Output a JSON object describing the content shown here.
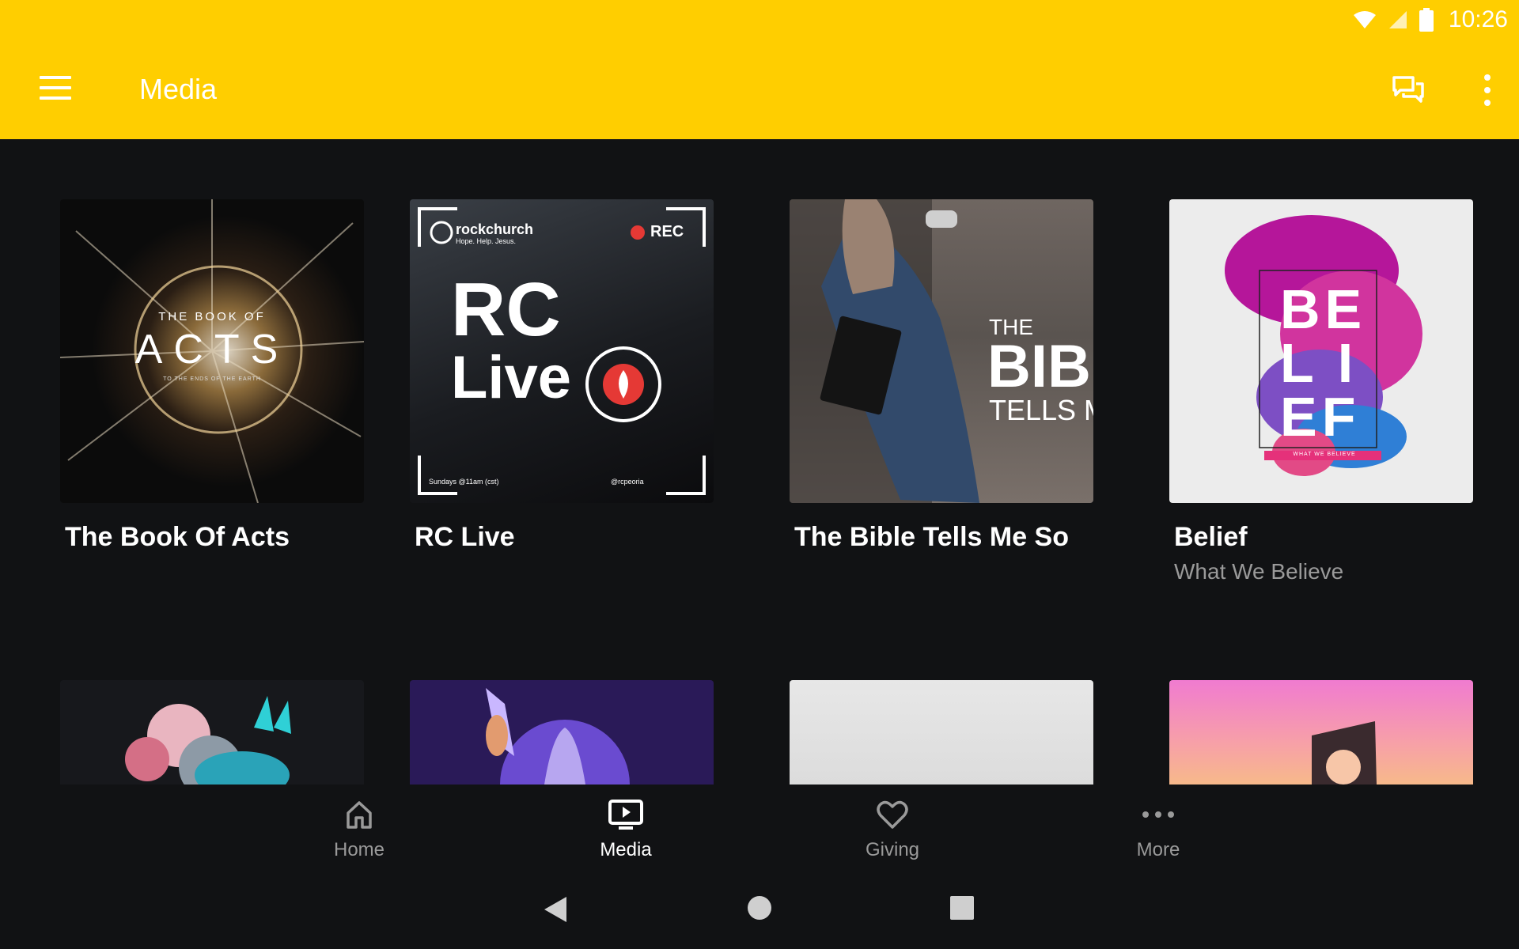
{
  "status_bar": {
    "time": "10:26"
  },
  "app_bar": {
    "title": "Media"
  },
  "grid": {
    "row1": [
      {
        "title": "The Book Of Acts",
        "subtitle": "",
        "art_text_top": "THE BOOK OF",
        "art_text_main": "ACTS",
        "art_text_bottom": "TO THE ENDS OF THE EARTH"
      },
      {
        "title": "RC Live",
        "subtitle": "",
        "art_brand": "rockchurch",
        "art_tagline": "Hope. Help. Jesus.",
        "art_rec": "REC",
        "art_line1": "RC",
        "art_line2": "Live",
        "art_footer_left": "Sundays @11am (cst)",
        "art_footer_right": "@rcpeoria"
      },
      {
        "title": "The Bible Tells Me So",
        "subtitle": "",
        "art_line1": "THE",
        "art_line2": "BIB",
        "art_line3": "TELLS M"
      },
      {
        "title": "Belief",
        "subtitle": "What We Believe",
        "art_line1": "BE",
        "art_line2": "LI",
        "art_line3": "EF",
        "art_footer": "WHAT WE BELIEVE"
      }
    ]
  },
  "bottom_nav": {
    "items": [
      {
        "label": "Home",
        "icon": "home-icon"
      },
      {
        "label": "Media",
        "icon": "media-icon",
        "active": true
      },
      {
        "label": "Giving",
        "icon": "heart-icon"
      },
      {
        "label": "More",
        "icon": "more-dots-icon"
      }
    ]
  },
  "colors": {
    "accent": "#FFCE00",
    "background": "#111214"
  }
}
